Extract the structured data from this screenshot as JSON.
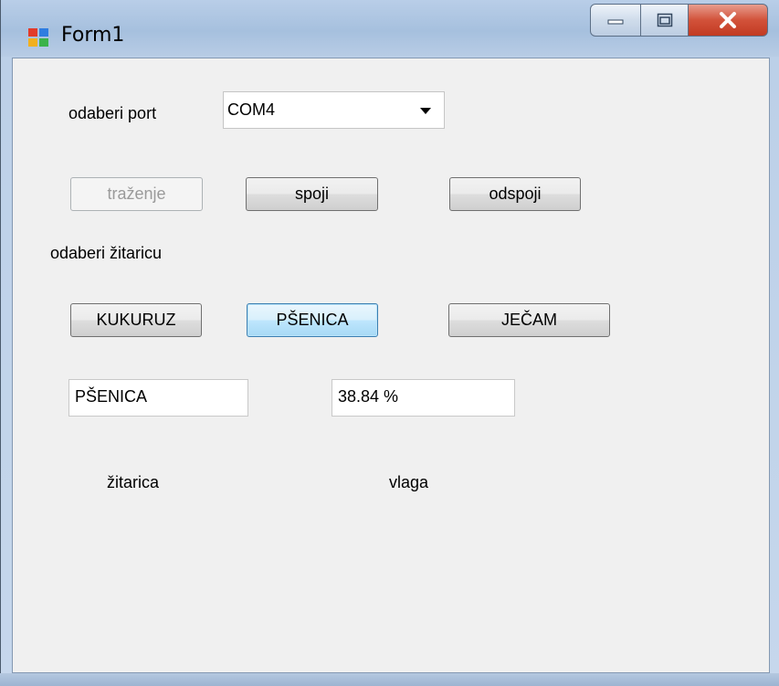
{
  "window": {
    "title": "Form1"
  },
  "port": {
    "label": "odaberi port",
    "selected": "COM4"
  },
  "connection": {
    "search_label": "traženje",
    "connect_label": "spoji",
    "disconnect_label": "odspoji"
  },
  "grain": {
    "label": "odaberi žitaricu",
    "buttons": [
      "KUKURUZ",
      "PŠENICA",
      "JEČAM"
    ]
  },
  "readout": {
    "grain_value": "PŠENICA",
    "moisture_value": "38.84 %",
    "grain_caption": "žitarica",
    "moisture_caption": "vlaga"
  }
}
